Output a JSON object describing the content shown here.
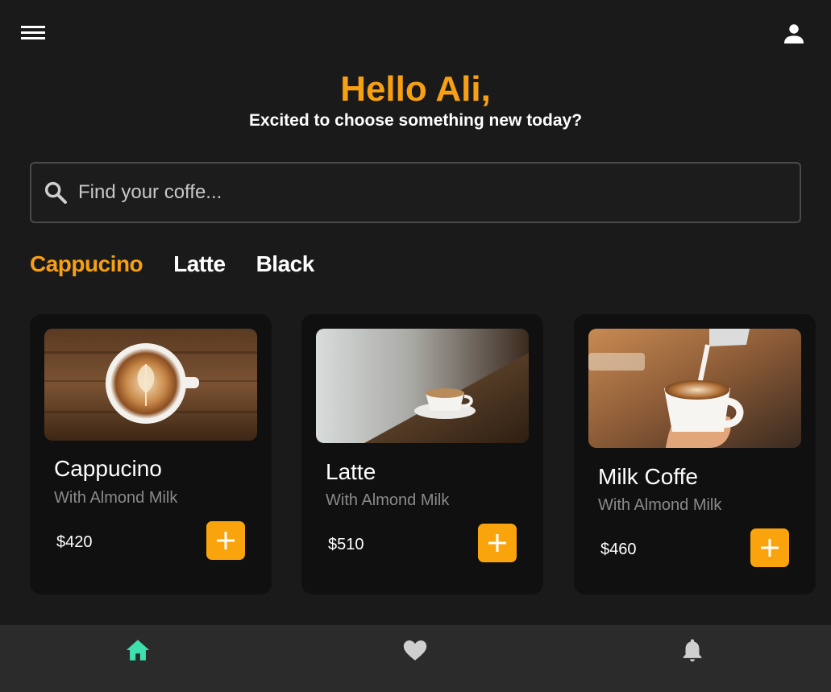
{
  "header": {
    "menu_icon": "menu-icon",
    "profile_icon": "person-icon"
  },
  "greeting": {
    "title": "Hello Ali,",
    "subtitle": "Excited to choose something new today?"
  },
  "search": {
    "placeholder": "Find your coffe...",
    "value": ""
  },
  "tabs": [
    {
      "label": "Cappucino",
      "active": true
    },
    {
      "label": "Latte",
      "active": false
    },
    {
      "label": "Black",
      "active": false
    }
  ],
  "products": [
    {
      "name": "Cappucino",
      "subtitle": "With Almond Milk",
      "price": "$420"
    },
    {
      "name": "Latte",
      "subtitle": "With Almond Milk",
      "price": "$510"
    },
    {
      "name": "Milk Coffe",
      "subtitle": "With Almond Milk",
      "price": "$460"
    }
  ],
  "bottom_nav": [
    {
      "icon": "home-icon",
      "active": true
    },
    {
      "icon": "heart-icon",
      "active": false
    },
    {
      "icon": "bell-icon",
      "active": false
    }
  ],
  "colors": {
    "accent": "#f7a014",
    "background": "#1a1a1a",
    "card": "#101010",
    "nav_active": "#3fe0b0",
    "nav_inactive": "#cfcfcf"
  }
}
